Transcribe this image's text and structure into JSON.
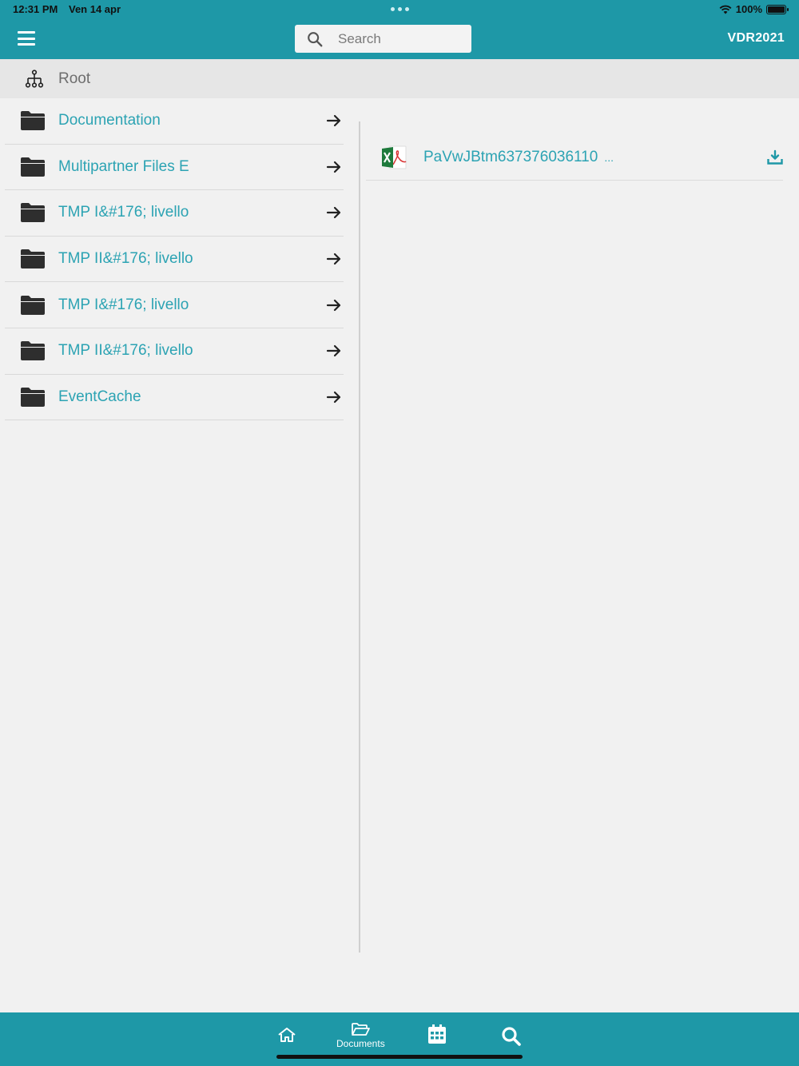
{
  "status_bar": {
    "time": "12:31 PM",
    "date": "Ven 14 apr",
    "battery": "100%"
  },
  "header": {
    "search_placeholder": "Search",
    "brand": "VDR2021",
    "background": "#1e98a7"
  },
  "breadcrumb": {
    "root_label": "Root"
  },
  "folders": [
    {
      "label": "Documentation"
    },
    {
      "label": "Multipartner Files E"
    },
    {
      "label": "TMP I&#176; livello"
    },
    {
      "label": "TMP II&#176; livello"
    },
    {
      "label": "TMP I&#176; livello"
    },
    {
      "label": "TMP II&#176; livello"
    },
    {
      "label": "EventCache"
    }
  ],
  "files": [
    {
      "name": "PaVwJBtm637376036110",
      "more": "...",
      "icon": "excel-pdf-icon"
    }
  ],
  "tabbar": {
    "home_icon": "home-icon",
    "documents_label": "Documents",
    "calendar_icon": "calendar-icon",
    "search_icon": "search-icon"
  },
  "colors": {
    "accent": "#1e98a7",
    "link": "#2ca3b3"
  }
}
